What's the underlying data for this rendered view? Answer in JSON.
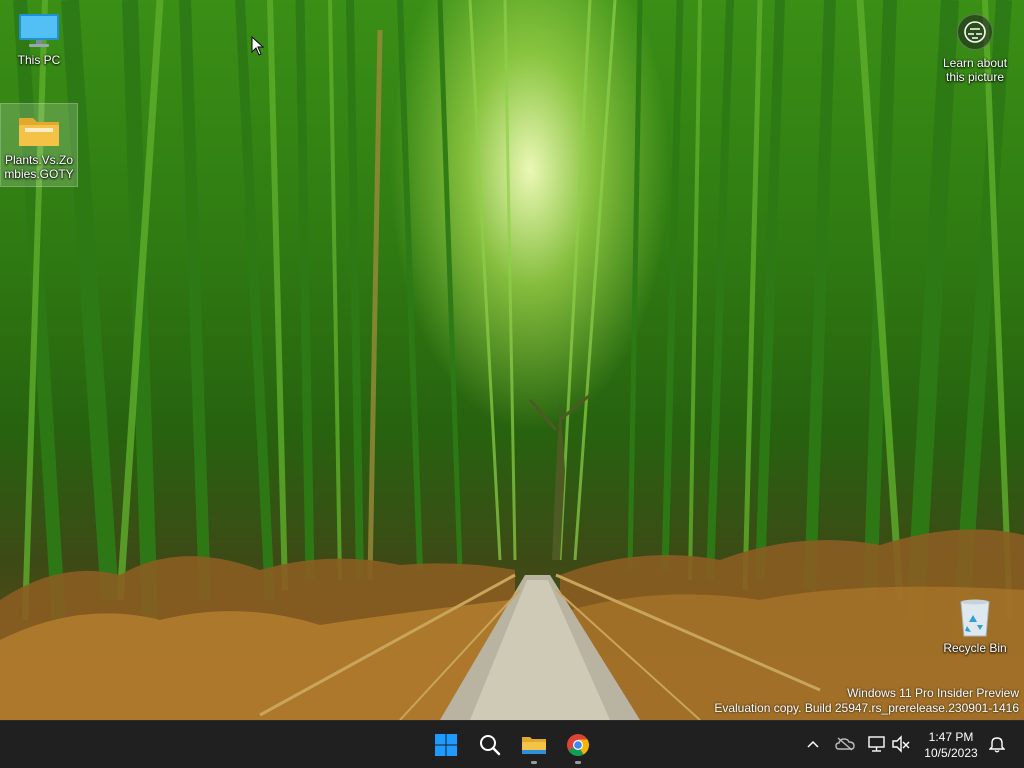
{
  "desktop": {
    "icons": [
      {
        "label": "This PC"
      },
      {
        "label": "Plants.Vs.Zombies.GOTY"
      },
      {
        "label": "Recycle Bin"
      }
    ],
    "learn_label": "Learn about this picture",
    "watermark": {
      "line1": "Windows 11 Pro Insider Preview",
      "line2": "Evaluation copy. Build 25947.rs_prerelease.230901-1416"
    }
  },
  "taskbar": {
    "apps": [
      {
        "icon": "windows-start-icon"
      },
      {
        "icon": "search-icon"
      },
      {
        "icon": "file-explorer-icon"
      },
      {
        "icon": "chrome-icon"
      }
    ],
    "tray_icons": [
      "chevron-up-icon",
      "onedrive-icon",
      "network-icon",
      "volume-muted-icon"
    ],
    "clock": {
      "time": "1:47 PM",
      "date": "10/5/2023"
    },
    "notification_icon": "bell-icon"
  },
  "colors": {
    "taskbar_bg": "#202020",
    "windows_blue": "#1f9bff",
    "folder_yellow": "#f4c247"
  }
}
